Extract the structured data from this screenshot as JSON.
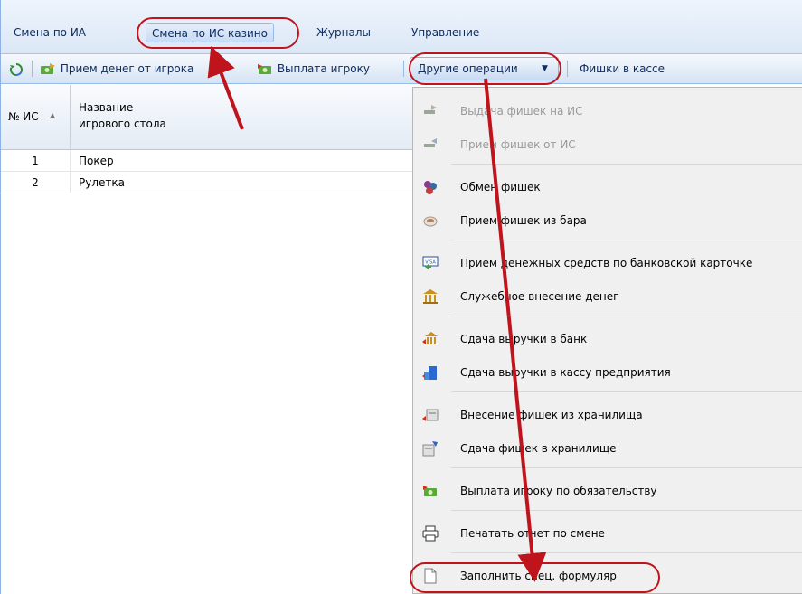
{
  "menu_tabs": [
    {
      "label": "Смена по ИА"
    },
    {
      "label": "Смена по ИС казино"
    },
    {
      "label": "Журналы"
    },
    {
      "label": "Управление"
    }
  ],
  "toolbar": {
    "receive_money": "Прием денег от игрока",
    "pay_player": "Выплата игроку",
    "other_ops": "Другие операции",
    "chips_in_cash": "Фишки в кассе"
  },
  "grid": {
    "col_num": "№ ИС",
    "col_name_line1": "Название",
    "col_name_line2": "игрового стола",
    "rows": [
      {
        "num": "1",
        "name": "Покер"
      },
      {
        "num": "2",
        "name": "Рулетка"
      }
    ]
  },
  "dropdown": {
    "items": [
      {
        "label": "Выдача фишек на ИС",
        "icon": "chips-to-table-icon",
        "disabled": true
      },
      {
        "label": "Прием фишек от ИС",
        "icon": "chips-from-table-icon",
        "disabled": true
      },
      {
        "label": "Обмен фишек",
        "icon": "chips-exchange-icon",
        "disabled": false
      },
      {
        "label": "Прием фишек из бара",
        "icon": "bar-cup-icon",
        "disabled": false
      },
      {
        "label": "Прием денежных средств по банковской карточке",
        "icon": "visa-card-icon",
        "disabled": false
      },
      {
        "label": "Служебное внесение денег",
        "icon": "bank-building-icon",
        "disabled": false
      },
      {
        "label": "Сдача выручки в банк",
        "icon": "bank-deposit-icon",
        "disabled": false
      },
      {
        "label": "Сдача выручки в кассу предприятия",
        "icon": "office-building-icon",
        "disabled": false
      },
      {
        "label": "Внесение фишек из хранилища",
        "icon": "storage-in-icon",
        "disabled": false
      },
      {
        "label": "Сдача фишек в хранилище",
        "icon": "storage-out-icon",
        "disabled": false
      },
      {
        "label": "Выплата игроку по обязательству",
        "icon": "money-pay-icon",
        "disabled": false
      },
      {
        "label": "Печатать отчет по смене",
        "icon": "printer-icon",
        "disabled": false
      },
      {
        "label": "Заполнить спец. формуляр",
        "icon": "document-icon",
        "disabled": false
      }
    ]
  },
  "colors": {
    "annotation_red": "#c0141c",
    "header_blue": "#dbe7f6"
  }
}
